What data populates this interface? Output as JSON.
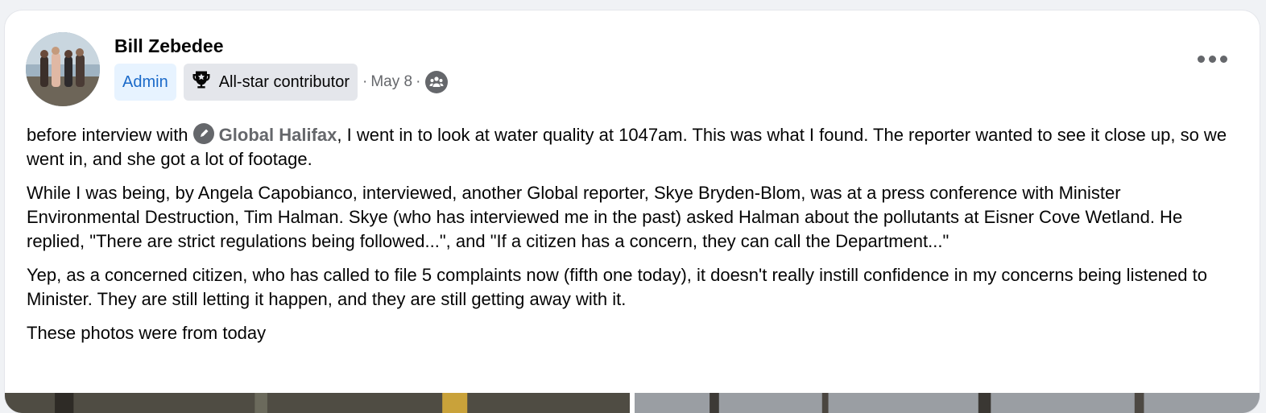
{
  "post": {
    "author": "Bill Zebedee",
    "admin_badge": "Admin",
    "contributor_badge": "All-star contributor",
    "date": "May 8",
    "separator": "·",
    "mention": "Global Halifax",
    "paragraph1_before": "before interview with ",
    "paragraph1_after": ", I went in to look at water quality at 1047am.  This was what I found.  The reporter wanted to see it close up, so we went in, and she got a lot of footage.",
    "paragraph2": "While I was being, by Angela Capobianco, interviewed, another Global reporter, Skye Bryden-Blom, was at a press conference with Minister Environmental Destruction, Tim Halman.  Skye (who has interviewed me in the past) asked Halman about the pollutants at Eisner Cove Wetland.  He replied, \"There are strict regulations being followed...\", and \"If a citizen has a concern, they can call the Department...\"",
    "paragraph3": "Yep, as a concerned citizen, who has called to file 5 complaints now (fifth one today), it doesn't really instill confidence in my concerns being listened to Minister.  They are still letting it happen, and they are still getting away with it.",
    "paragraph4": "These photos were from today"
  },
  "icons": {
    "trophy": "trophy-icon",
    "audience": "group-audience-icon",
    "more": "more-options-icon",
    "mention": "page-mention-icon"
  },
  "colors": {
    "admin_text": "#1b6ac9",
    "admin_bg": "#e7f3ff",
    "badge_bg": "#e4e6eb",
    "meta_text": "#65676b"
  }
}
